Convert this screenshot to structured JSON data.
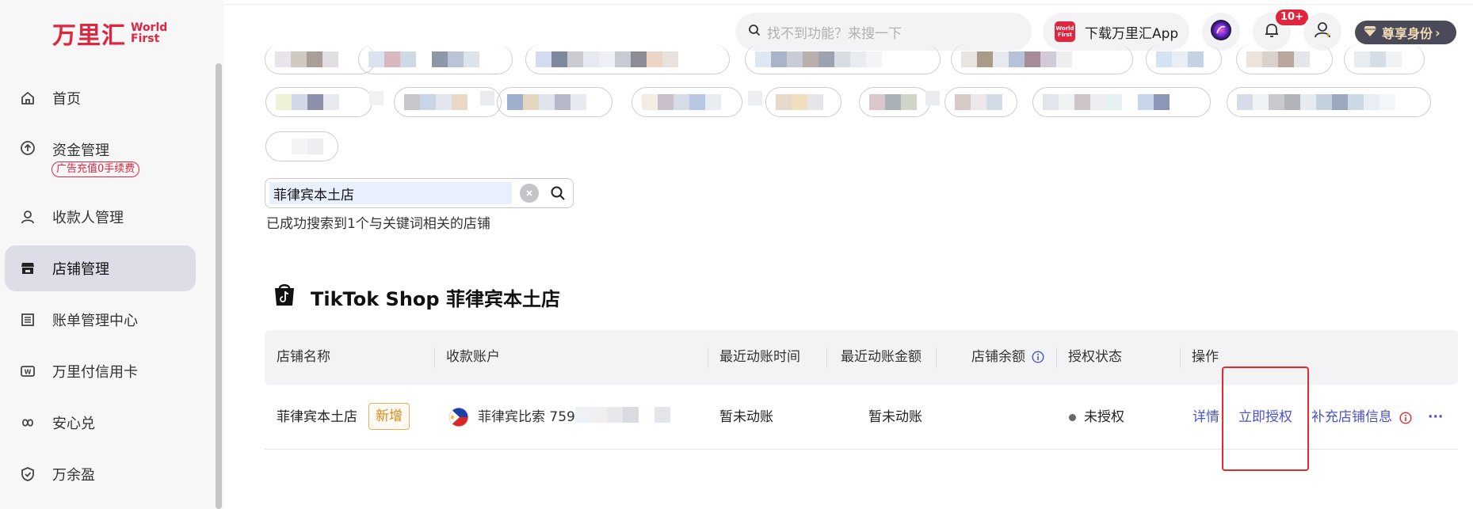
{
  "brand": {
    "name_cn": "万里汇",
    "name_en_1": "World",
    "name_en_2": "First"
  },
  "sidebar": {
    "items": [
      {
        "label": "首页",
        "icon": "home-icon"
      },
      {
        "label": "资金管理",
        "icon": "fund-icon",
        "promo": "广告充值0手续费"
      },
      {
        "label": "收款人管理",
        "icon": "user-icon"
      },
      {
        "label": "店铺管理",
        "icon": "store-icon",
        "active": true
      },
      {
        "label": "账单管理中心",
        "icon": "bill-icon"
      },
      {
        "label": "万里付信用卡",
        "icon": "card-icon"
      },
      {
        "label": "安心兑",
        "icon": "exchange-icon"
      },
      {
        "label": "万余盈",
        "icon": "shield-icon"
      }
    ]
  },
  "header": {
    "search_placeholder": "找不到功能？来搜一下",
    "download_label": "下载万里汇App",
    "download_logo_1": "World",
    "download_logo_2": "First",
    "notification_badge": "10+",
    "vip_label": "尊享身份"
  },
  "filter": {
    "value": "菲律宾本土店",
    "result": "已成功搜索到1个与关键词相关的店铺"
  },
  "section": {
    "title": "TikTok Shop 菲律宾本土店"
  },
  "table": {
    "headers": [
      "店铺名称",
      "收款账户",
      "最近动账时间",
      "最近动账金额",
      "店铺余额",
      "授权状态",
      "操作"
    ],
    "row": {
      "store_name": "菲律宾本土店",
      "tag": "新增",
      "account": "菲律宾比索 759",
      "last_time": "暂未动账",
      "last_amount": "暂未动账",
      "status": "未授权",
      "actions": [
        "详情",
        "立即授权",
        "补充店铺信息",
        "···"
      ]
    }
  },
  "colors": {
    "brand": "#e0263e",
    "link": "#4a52c9",
    "active_nav": "#dcdde6"
  }
}
